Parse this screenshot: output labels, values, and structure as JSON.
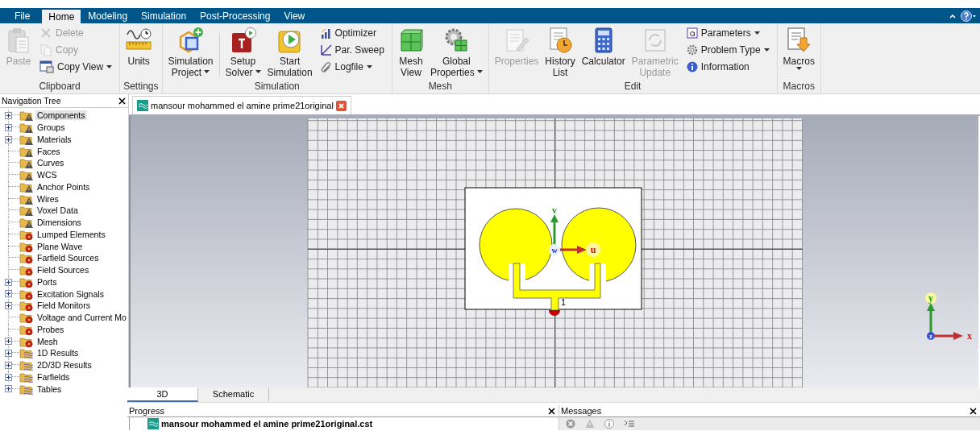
{
  "menu": {
    "file": "File",
    "tabs": [
      {
        "label": "Home",
        "selected": true
      },
      {
        "label": "Modeling",
        "selected": false
      },
      {
        "label": "Simulation",
        "selected": false
      },
      {
        "label": "Post-Processing",
        "selected": false
      },
      {
        "label": "View",
        "selected": false
      }
    ]
  },
  "ribbon": {
    "groups": [
      {
        "label": "Clipboard",
        "items": [
          {
            "kind": "large",
            "lines": [
              "Paste"
            ],
            "disabled": true,
            "dropdown": false
          },
          {
            "kind": "small",
            "lines": [
              "Delete"
            ],
            "disabled": true,
            "dropdown": false
          },
          {
            "kind": "small",
            "lines": [
              "Copy"
            ],
            "disabled": true,
            "dropdown": false
          },
          {
            "kind": "small",
            "lines": [
              "Copy View"
            ],
            "disabled": false,
            "dropdown": true
          }
        ]
      },
      {
        "label": "Settings",
        "items": [
          {
            "kind": "large",
            "lines": [
              "Units"
            ],
            "disabled": false,
            "dropdown": false
          }
        ]
      },
      {
        "label": "Simulation",
        "items": [
          {
            "kind": "large",
            "lines": [
              "Simulation",
              "Project"
            ],
            "disabled": false,
            "dropdown": true
          },
          {
            "kind": "large",
            "lines": [
              "Setup",
              "Solver"
            ],
            "disabled": false,
            "dropdown": true
          },
          {
            "kind": "large",
            "lines": [
              "Start",
              "Simulation"
            ],
            "disabled": false,
            "dropdown": false
          },
          {
            "kind": "small",
            "lines": [
              "Optimizer"
            ],
            "disabled": false,
            "dropdown": false
          },
          {
            "kind": "small",
            "lines": [
              "Par. Sweep"
            ],
            "disabled": false,
            "dropdown": false
          },
          {
            "kind": "small",
            "lines": [
              "Logfile"
            ],
            "disabled": false,
            "dropdown": true
          }
        ]
      },
      {
        "label": "Mesh",
        "items": [
          {
            "kind": "large",
            "lines": [
              "Mesh",
              "View"
            ],
            "disabled": false,
            "dropdown": false
          },
          {
            "kind": "large",
            "lines": [
              "Global",
              "Properties"
            ],
            "disabled": false,
            "dropdown": true
          }
        ]
      },
      {
        "label": "Edit",
        "items": [
          {
            "kind": "large",
            "lines": [
              "Properties"
            ],
            "disabled": true,
            "dropdown": false
          },
          {
            "kind": "large",
            "lines": [
              "History",
              "List"
            ],
            "disabled": false,
            "dropdown": false
          },
          {
            "kind": "large",
            "lines": [
              "Calculator"
            ],
            "disabled": false,
            "dropdown": false
          },
          {
            "kind": "large",
            "lines": [
              "Parametric",
              "Update"
            ],
            "disabled": true,
            "dropdown": false
          },
          {
            "kind": "small",
            "lines": [
              "Parameters"
            ],
            "disabled": false,
            "dropdown": true
          },
          {
            "kind": "small",
            "lines": [
              "Problem Type"
            ],
            "disabled": false,
            "dropdown": true
          },
          {
            "kind": "small",
            "lines": [
              "Information"
            ],
            "disabled": false,
            "dropdown": false
          }
        ]
      },
      {
        "label": "Macros",
        "items": [
          {
            "kind": "large",
            "lines": [
              "Macros"
            ],
            "disabled": false,
            "dropdown": true
          }
        ]
      }
    ]
  },
  "navigation_tree": {
    "title": "Navigation Tree",
    "items": [
      {
        "label": "Components",
        "kind": "warning",
        "expandable": true,
        "selected": true
      },
      {
        "label": "Groups",
        "kind": "warning",
        "expandable": true,
        "selected": false
      },
      {
        "label": "Materials",
        "kind": "warning",
        "expandable": true,
        "selected": false
      },
      {
        "label": "Faces",
        "kind": "warning",
        "expandable": false,
        "selected": false
      },
      {
        "label": "Curves",
        "kind": "warning",
        "expandable": false,
        "selected": false
      },
      {
        "label": "WCS",
        "kind": "warning",
        "expandable": false,
        "selected": false
      },
      {
        "label": "Anchor Points",
        "kind": "warning",
        "expandable": false,
        "selected": false
      },
      {
        "label": "Wires",
        "kind": "warning",
        "expandable": false,
        "selected": false
      },
      {
        "label": "Voxel Data",
        "kind": "warning",
        "expandable": false,
        "selected": false
      },
      {
        "label": "Dimensions",
        "kind": "warning",
        "expandable": false,
        "selected": false
      },
      {
        "label": "Lumped Elements",
        "kind": "gear",
        "expandable": false,
        "selected": false
      },
      {
        "label": "Plane Wave",
        "kind": "gear",
        "expandable": false,
        "selected": false
      },
      {
        "label": "Farfield Sources",
        "kind": "gear",
        "expandable": false,
        "selected": false
      },
      {
        "label": "Field Sources",
        "kind": "gear",
        "expandable": false,
        "selected": false
      },
      {
        "label": "Ports",
        "kind": "gear",
        "expandable": true,
        "selected": false
      },
      {
        "label": "Excitation Signals",
        "kind": "gear",
        "expandable": true,
        "selected": false
      },
      {
        "label": "Field Monitors",
        "kind": "gear",
        "expandable": true,
        "selected": false
      },
      {
        "label": "Voltage and Current Mo",
        "kind": "gear",
        "expandable": false,
        "selected": false
      },
      {
        "label": "Probes",
        "kind": "gear",
        "expandable": false,
        "selected": false
      },
      {
        "label": "Mesh",
        "kind": "gear",
        "expandable": true,
        "selected": false
      },
      {
        "label": "1D Results",
        "kind": "results",
        "expandable": true,
        "selected": false
      },
      {
        "label": "2D/3D Results",
        "kind": "results",
        "expandable": true,
        "selected": false
      },
      {
        "label": "Farfields",
        "kind": "results",
        "expandable": true,
        "selected": false
      },
      {
        "label": "Tables",
        "kind": "results",
        "expandable": true,
        "selected": false
      }
    ]
  },
  "document_tab": {
    "title": "mansour mohammed el amine prime21original"
  },
  "viewport": {
    "port_label": "1",
    "local_axes": {
      "u": "u",
      "v": "v",
      "w": "w"
    },
    "global_axes": {
      "x": "x",
      "y": "y",
      "z": "z"
    }
  },
  "view_tabs": [
    {
      "label": "3D",
      "selected": true
    },
    {
      "label": "Schematic",
      "selected": false
    }
  ],
  "progress": {
    "title": "Progress",
    "items": [
      "mansour mohammed el amine prime21original.cst"
    ]
  },
  "messages": {
    "title": "Messages"
  }
}
